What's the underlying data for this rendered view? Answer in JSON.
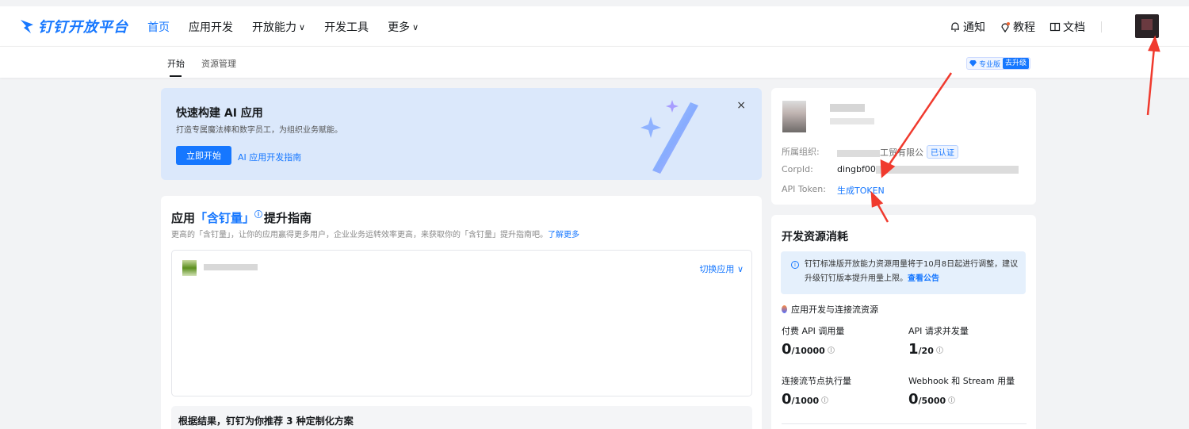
{
  "brand": {
    "name": "钉钉开放平台",
    "color": "#1677ff"
  },
  "nav": {
    "items": [
      {
        "label": "首页",
        "active": true,
        "chevron": false
      },
      {
        "label": "应用开发",
        "active": false,
        "chevron": false
      },
      {
        "label": "开放能力",
        "active": false,
        "chevron": true
      },
      {
        "label": "开发工具",
        "active": false,
        "chevron": false
      },
      {
        "label": "更多",
        "active": false,
        "chevron": true
      }
    ],
    "right": {
      "notify": "通知",
      "tutorial": "教程",
      "docs": "文档"
    }
  },
  "subnav": {
    "tabs": [
      {
        "label": "开始"
      },
      {
        "label": "资源管理"
      }
    ],
    "edition": "专业版",
    "upgrade": "去升级"
  },
  "banner": {
    "title": "快速构建 AI 应用",
    "subtitle": "打造专属魔法棒和数字员工，为组织业务赋能。",
    "button": "立即开始",
    "link": "AI 应用开发指南",
    "close": "×"
  },
  "guide": {
    "title_prefix": "应用",
    "title_highlight": "「含钉量」",
    "title_suffix": "提升指南",
    "description": "更高的「含钉量」，让你的应用赢得更多用户，企业业务运转效率更高，来获取你的「含钉量」提升指南吧。",
    "learn_more": "了解更多",
    "switch_app": "切换应用",
    "recommend": "根据结果，钉钉为你推荐 3 种定制化方案"
  },
  "org": {
    "org_label": "所属组织:",
    "org_value_visible": "工贸有限公",
    "verified": "已认证",
    "corpid_label": "CorpId:",
    "corpid_value_visible": "dingbf00",
    "token_label": "API Token:",
    "token_link": "生成TOKEN"
  },
  "resources": {
    "title": "开发资源消耗",
    "notice": "钉钉标准版开放能力资源用量将于10月8日起进行调整，建议升级钉钉版本提升用量上限。",
    "notice_link": "查看公告",
    "section": "应用开发与连接流资源",
    "metrics": [
      {
        "label": "付费 API 调用量",
        "used": "0",
        "limit": "/10000"
      },
      {
        "label": "API 请求并发量",
        "used": "1",
        "limit": "/20"
      },
      {
        "label": "连接流节点执行量",
        "used": "0",
        "limit": "/1000"
      },
      {
        "label": "Webhook 和 Stream 用量",
        "used": "0",
        "limit": "/5000"
      }
    ]
  },
  "annotation_color": "#f03a2e"
}
